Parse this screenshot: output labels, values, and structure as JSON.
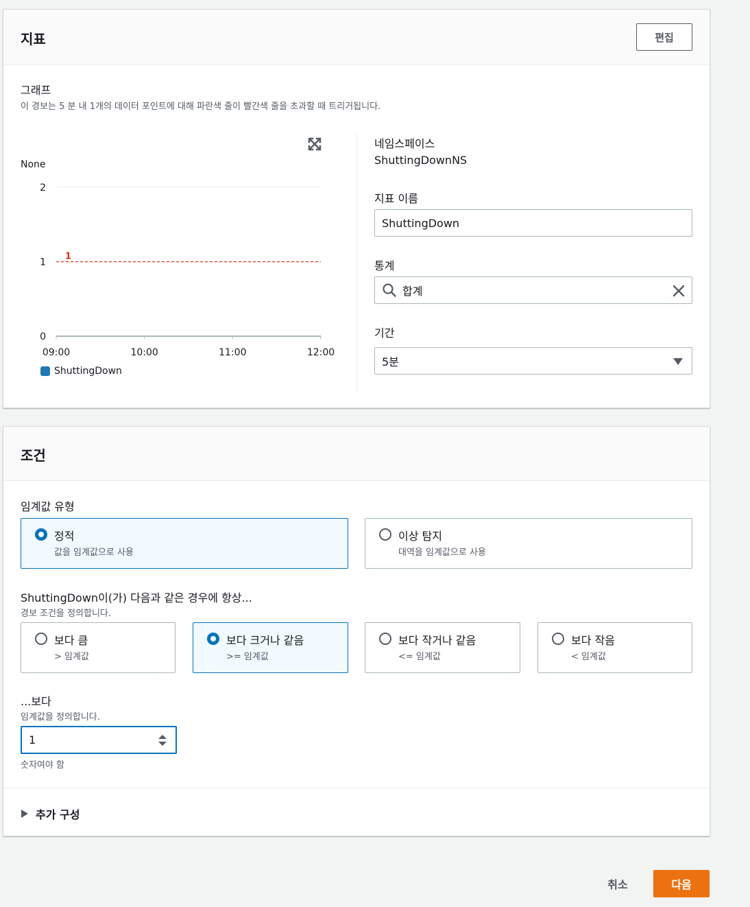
{
  "metric": {
    "title": "지표",
    "edit_label": "편집",
    "graph": {
      "title": "그래프",
      "description": "이 경보는 5 분 내 1개의 데이터 포인트에 대해 파란색 줄이 빨간색 줄을 초과할 때 트리거됩니다."
    },
    "namespace_label": "네임스페이스",
    "namespace_value": "ShuttingDownNS",
    "metric_name_label": "지표 이름",
    "metric_name_value": "ShuttingDown",
    "statistic_label": "통계",
    "statistic_value": "합계",
    "period_label": "기간",
    "period_value": "5분"
  },
  "chart_data": {
    "type": "line",
    "unit_label": "None",
    "x_ticks": [
      "09:00",
      "10:00",
      "11:00",
      "12:00"
    ],
    "ylim": [
      0,
      2
    ],
    "y_ticks": [
      0,
      1,
      2
    ],
    "series": [
      {
        "name": "ShuttingDown",
        "color": "#1f77b4",
        "values": []
      }
    ],
    "threshold": {
      "value": 1,
      "label": "1",
      "color": "#d13212",
      "style": "dashed"
    },
    "grid": true
  },
  "conditions": {
    "title": "조건",
    "threshold_type_label": "임계값 유형",
    "threshold_types": [
      {
        "label": "정적",
        "desc": "값을 임계값으로 사용",
        "selected": true
      },
      {
        "label": "이상 탐지",
        "desc": "대역을 임계값으로 사용",
        "selected": false
      }
    ],
    "whenever_label": "ShuttingDown이(가) 다음과 같은 경우에 항상...",
    "whenever_sub": "경보 조건을 정의합니다.",
    "operators": [
      {
        "label": "보다 큼",
        "desc": "> 임계값",
        "selected": false
      },
      {
        "label": "보다 크거나 같음",
        "desc": ">= 임계값",
        "selected": true
      },
      {
        "label": "보다 작거나 같음",
        "desc": "<= 임계값",
        "selected": false
      },
      {
        "label": "보다 작음",
        "desc": "< 임계값",
        "selected": false
      }
    ],
    "than_label": "...보다",
    "than_sub": "임계값을 정의합니다.",
    "threshold_value": "1",
    "threshold_hint": "숫자여야 함",
    "additional_config_label": "추가 구성"
  },
  "footer": {
    "cancel_label": "취소",
    "next_label": "다음"
  },
  "colors": {
    "primary_button": "#ec7211",
    "selected_border": "#0073bb",
    "selected_bg": "#f1faff",
    "threshold_line": "#d13212",
    "series": "#1f77b4"
  }
}
